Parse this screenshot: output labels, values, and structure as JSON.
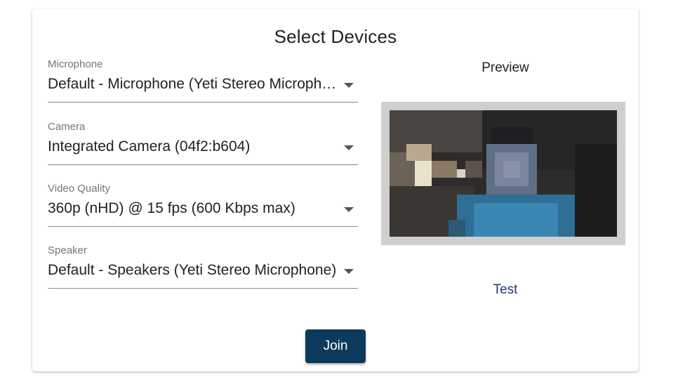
{
  "dialog": {
    "title": "Select Devices"
  },
  "fields": {
    "microphone": {
      "label": "Microphone",
      "value": "Default - Microphone (Yeti Stereo Microphone)"
    },
    "camera": {
      "label": "Camera",
      "value": "Integrated Camera (04f2:b604)"
    },
    "video_quality": {
      "label": "Video Quality",
      "value": "360p (nHD) @ 15 fps (600 Kbps max)"
    },
    "speaker": {
      "label": "Speaker",
      "value": "Default - Speakers (Yeti Stereo Microphone)"
    }
  },
  "preview": {
    "label": "Preview",
    "test_label": "Test"
  },
  "actions": {
    "join_label": "Join"
  },
  "colors": {
    "primary_button": "#0c3a5c",
    "link": "#1f3a63"
  },
  "icons": {
    "dropdown": "caret-down-icon"
  }
}
